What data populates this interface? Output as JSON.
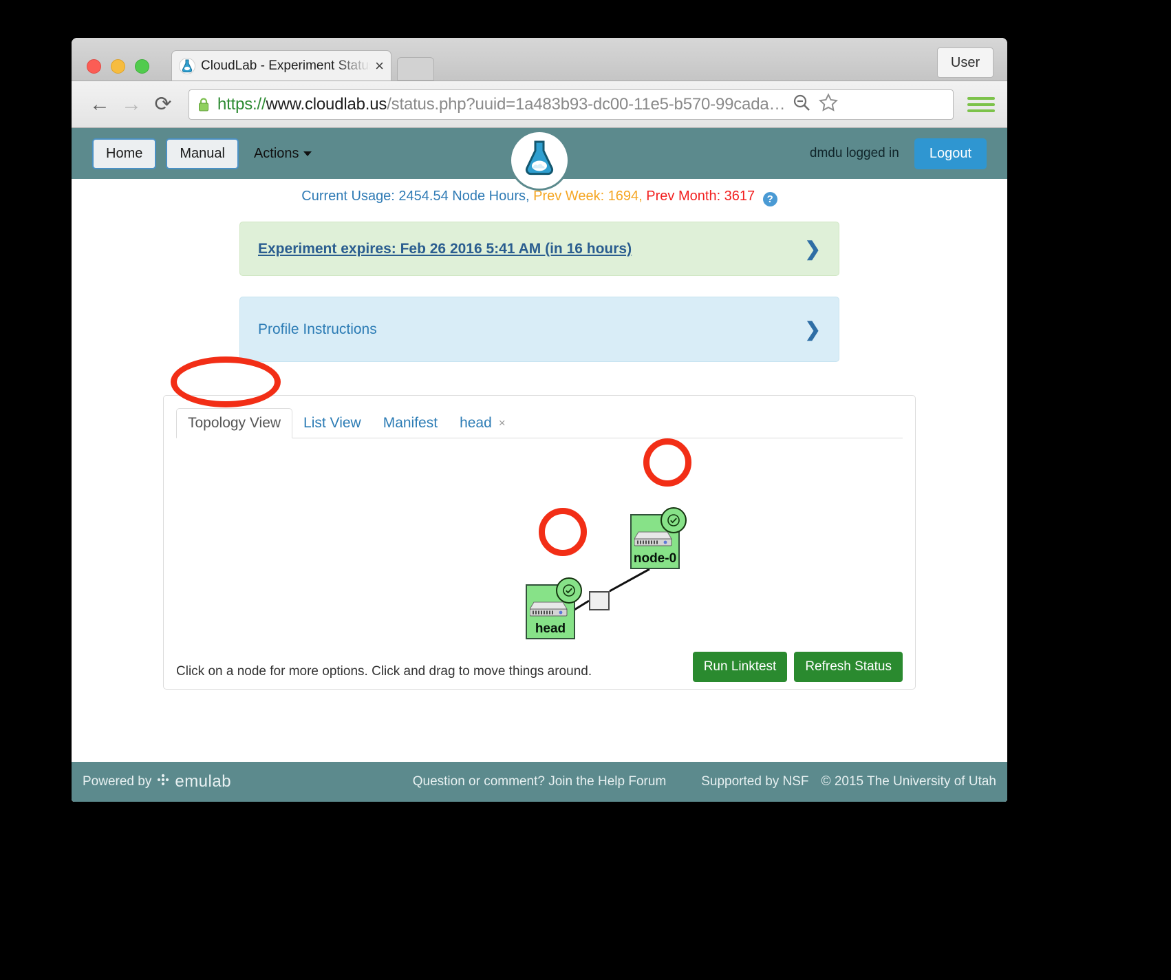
{
  "browser": {
    "tab": {
      "title": "CloudLab - Experiment Status",
      "close_label": "×"
    },
    "new_tab_label": "",
    "user_button": "User",
    "back_icon": "←",
    "forward_icon": "→",
    "reload_icon": "⟳",
    "url": {
      "scheme": "https://",
      "host": "www.cloudlab.us",
      "rest": "/status.php?uuid=1a483b93-dc00-11e5-b570-99cada…",
      "full": "https://www.cloudlab.us/status.php?uuid=1a483b93-dc00-11e5-b570-99cada..."
    },
    "zoom_out_icon": "search-minus-icon",
    "bookmark_icon": "star-icon",
    "menu_icon": "hamburger-menu-icon"
  },
  "navbar": {
    "home": "Home",
    "manual": "Manual",
    "actions": "Actions",
    "logged_in": "dmdu logged in",
    "logout": "Logout",
    "brand_icon": "cloudlab-flask-logo"
  },
  "usage": {
    "current": "Current Usage: 2454.54 Node Hours,",
    "prev_week": "Prev Week: 1694,",
    "prev_month": "Prev Month: 3617",
    "help": "?"
  },
  "alerts": [
    {
      "text": "Experiment expires: Feb 26 2016 5:41 AM (in 16 hours)",
      "chevron": "❯"
    },
    {
      "text": "Profile Instructions",
      "chevron": "❯"
    }
  ],
  "panel": {
    "tabs": [
      {
        "label": "Topology View",
        "active": true
      },
      {
        "label": "List View",
        "active": false
      },
      {
        "label": "Manifest",
        "active": false
      },
      {
        "label": "head",
        "active": false,
        "closable": true,
        "close_label": "×"
      }
    ],
    "topology": {
      "nodes": [
        {
          "id": "node-0",
          "label": "node-0",
          "status": "ready",
          "check": "✓"
        },
        {
          "id": "head",
          "label": "head",
          "status": "ready",
          "check": "✓"
        }
      ],
      "link": {
        "label": "",
        "type": "lan-switch"
      }
    },
    "hint": "Click on a node for more options. Click and drag to move things around.",
    "buttons": {
      "linktest": "Run Linktest",
      "refresh": "Refresh Status"
    }
  },
  "footer": {
    "powered_by": "Powered by",
    "emulab": "emulab",
    "help": "Question or comment? Join the Help Forum",
    "nsf": "Supported by NSF",
    "copyright": "© 2015 The University of Utah"
  },
  "colors": {
    "teal": "#5c8a8d",
    "node_green": "#87e288",
    "button_green": "#2a8a2f",
    "link_blue": "#2c7cb5",
    "annotation_red": "#f22e16"
  }
}
